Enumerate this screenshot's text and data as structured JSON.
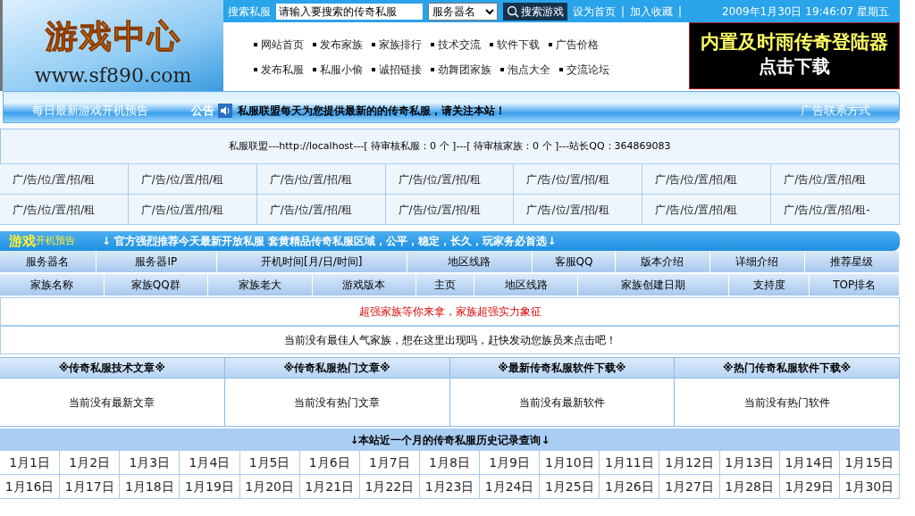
{
  "header": {
    "logo": {
      "title": "游戏中心",
      "url": "www.sf890.com"
    },
    "search": {
      "label": "搜索私服",
      "value": "请输入要搜索的传奇私服",
      "select": "服务器名",
      "button": "搜索游戏"
    },
    "top_links": [
      "设为首页",
      "加入收藏"
    ],
    "link_separator": "|",
    "datetime": "2009年1月30日 19:46:07 星期五",
    "nav_rows": [
      [
        "网站首页",
        "发布家族",
        "家族排行",
        "技术交流",
        "软件下载",
        "广告价格"
      ],
      [
        "发布私服",
        "私服小偷",
        "诚招链接",
        "劲舞团家族",
        "泡点大全",
        "交流论坛"
      ]
    ],
    "banner": {
      "line1": "内置及时雨传奇登陆器",
      "line2": "点击下载"
    }
  },
  "notice": {
    "left_label": "每日最新游戏开机预告",
    "label": "公告",
    "message": "私服联盟每天为您提供最新的的传奇私服，请关注本站！",
    "right_link": "广告联系方式"
  },
  "info_line": "私服联盟---http://localhost---[ 待审核私服：0 个 ]---[ 待审核家族：0 个 ]---站长QQ：364869083",
  "ad_cells": [
    "广/告/位/置/招/租",
    "广/告/位/置/招/租",
    "广/告/位/置/招/租",
    "广/告/位/置/招/租",
    "广/告/位/置/招/租",
    "广/告/位/置/招/租",
    "广/告/位/置/招/租",
    "广/告/位/置/招/租",
    "广/告/位/置/招/租",
    "广/告/位/置/招/租",
    "广/告/位/置/招/租",
    "广/告/位/置/招/租",
    "广/告/位/置/招/租",
    "广/告/位/置/招/租-"
  ],
  "promo": {
    "title": "游戏",
    "subtitle": "开机预告",
    "message": "↓ 官方强烈推荐今天最新开放私服 套黄精品传奇私服区域，公平，稳定，长久，玩家务必首选↓"
  },
  "server_columns": [
    "服务器名",
    "服务器IP",
    "开机时间[月/日/时间]",
    "地区线路",
    "客服QQ",
    "版本介绍",
    "详细介绍",
    "推荐星级"
  ],
  "family_columns": [
    "家族名称",
    "家族QQ群",
    "家族老大",
    "游戏版本",
    "主页",
    "地区线路",
    "家族创建日期",
    "支持度",
    "TOP排名"
  ],
  "family_slogan": "超强家族等你来拿，家族超强实力象征",
  "family_empty": "当前没有最佳人气家族，想在这里出现吗，赶快发动您族员来点击吧！",
  "article_sections": [
    {
      "title": "※传奇私服技术文章※",
      "empty": "当前没有最新文章"
    },
    {
      "title": "※传奇私服热门文章※",
      "empty": "当前没有热门文章"
    },
    {
      "title": "※最新传奇私服软件下载※",
      "empty": "当前没有最新软件"
    },
    {
      "title": "※热门传奇私服软件下载※",
      "empty": "当前没有热门软件"
    }
  ],
  "history": {
    "title": "↓本站近一个月的传奇私服历史记录查询↓",
    "rows": [
      [
        "1月1日",
        "1月2日",
        "1月3日",
        "1月4日",
        "1月5日",
        "1月6日",
        "1月7日",
        "1月8日",
        "1月9日",
        "1月10日",
        "1月11日",
        "1月12日",
        "1月13日",
        "1月14日",
        "1月15日"
      ],
      [
        "1月16日",
        "1月17日",
        "1月18日",
        "1月19日",
        "1月20日",
        "1月21日",
        "1月22日",
        "1月23日",
        "1月24日",
        "1月25日",
        "1月26日",
        "1月27日",
        "1月28日",
        "1月29日",
        "1月30日"
      ]
    ]
  }
}
